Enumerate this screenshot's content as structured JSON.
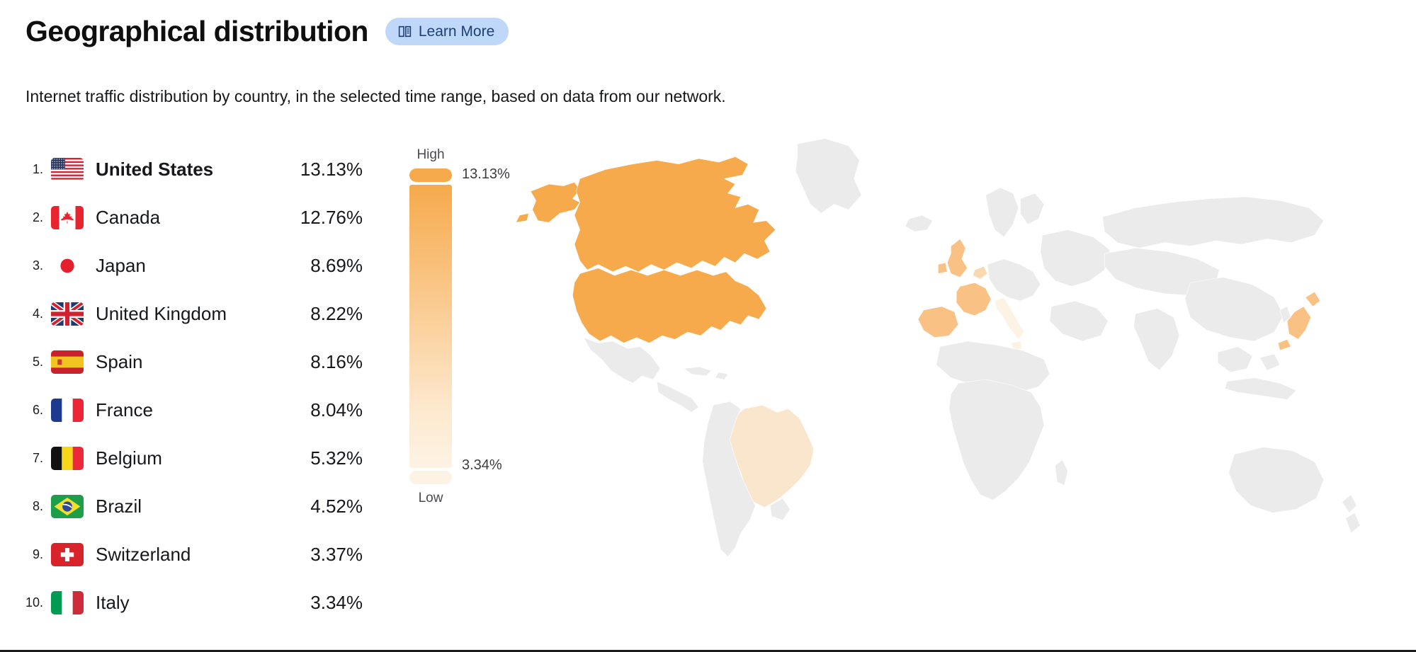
{
  "header": {
    "title": "Geographical distribution",
    "learn_more_label": "Learn More",
    "learn_more_icon": "book-icon",
    "badge_bg": "#bfd8fa",
    "badge_fg": "#1d3f72"
  },
  "subtitle": "Internet traffic distribution by country, in the selected time range, based on data from our network.",
  "legend": {
    "high_label": "High",
    "low_label": "Low",
    "max_value": "13.13%",
    "min_value": "3.34%",
    "color_high": "#f6aa4c",
    "color_low": "#fdf3e4",
    "inactive_color": "#ebebeb"
  },
  "countries": [
    {
      "rank": "1.",
      "name": "United States",
      "value": "13.13%",
      "flag": "us",
      "highlighted": true
    },
    {
      "rank": "2.",
      "name": "Canada",
      "value": "12.76%",
      "flag": "ca",
      "highlighted": false
    },
    {
      "rank": "3.",
      "name": "Japan",
      "value": "8.69%",
      "flag": "jp",
      "highlighted": false
    },
    {
      "rank": "4.",
      "name": "United Kingdom",
      "value": "8.22%",
      "flag": "gb",
      "highlighted": false
    },
    {
      "rank": "5.",
      "name": "Spain",
      "value": "8.16%",
      "flag": "es",
      "highlighted": false
    },
    {
      "rank": "6.",
      "name": "France",
      "value": "8.04%",
      "flag": "fr",
      "highlighted": false
    },
    {
      "rank": "7.",
      "name": "Belgium",
      "value": "5.32%",
      "flag": "be",
      "highlighted": false
    },
    {
      "rank": "8.",
      "name": "Brazil",
      "value": "4.52%",
      "flag": "br",
      "highlighted": false
    },
    {
      "rank": "9.",
      "name": "Switzerland",
      "value": "3.37%",
      "flag": "ch",
      "highlighted": false
    },
    {
      "rank": "10.",
      "name": "Italy",
      "value": "3.34%",
      "flag": "it",
      "highlighted": false
    }
  ],
  "chart_data": {
    "type": "choropleth",
    "title": "Geographical distribution",
    "unit": "percent",
    "categories": [
      "United States",
      "Canada",
      "Japan",
      "United Kingdom",
      "Spain",
      "France",
      "Belgium",
      "Brazil",
      "Switzerland",
      "Italy"
    ],
    "values": [
      13.13,
      12.76,
      8.69,
      8.22,
      8.16,
      8.04,
      5.32,
      4.52,
      3.37,
      3.34
    ],
    "range": [
      3.34,
      13.13
    ],
    "colorscale": [
      "#fdf3e4",
      "#f6aa4c"
    ],
    "legend_position": "left-of-map",
    "no_data_color": "#ebebeb"
  }
}
